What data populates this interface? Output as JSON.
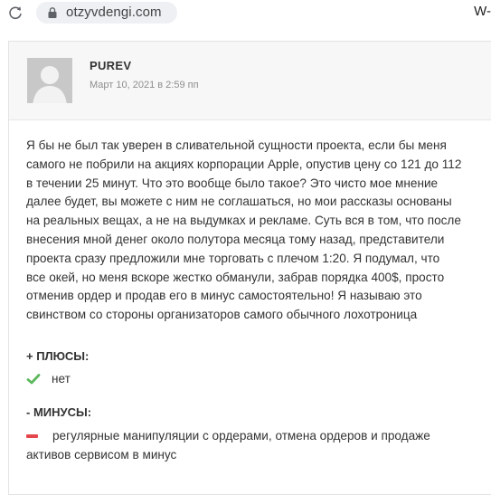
{
  "browser": {
    "url": "otzyvdengi.com",
    "tab_fragment": "W-"
  },
  "comment": {
    "author": "PUREV",
    "date": "Март 10, 2021 в 2:59 пп",
    "text": "Я бы не был так уверен в сливательной сущности проекта, если бы меня\nсамого не побрили на акциях корпорации Apple, опустив цену со 121 до 112\nв течении 25 минут. Что это вообще было такое? Это чисто мое мнение\nдалее будет, вы можете с ним не соглашаться, но мои рассказы основаны\nна реальных вещах, а не на выдумках и рекламе. Суть вся в том, что после\nвнесения мной денег около полутора месяца тому назад, представители\nпроекта сразу предложили мне торговать с плечом 1:20. Я подумал, что\nвсе окей, но меня вскоре жестко обманули, забрав порядка 400$, просто\nотменив ордер и продав его в минус самостоятельно! Я называю это\nсвинством со стороны организаторов самого обычного лохотроница",
    "pros_label": "+ ПЛЮСЫ:",
    "pros_text": "нет",
    "cons_label": "- МИНУСЫ:",
    "cons_text": "регулярные манипуляции с ордерами, отмена ордеров и продаже активов сервисом в минус"
  },
  "icons": {
    "reload": "reload-icon",
    "lock": "lock-icon",
    "check": "check-icon",
    "minus": "minus-icon"
  },
  "colors": {
    "check": "#5cb85c",
    "minus": "#e4464b",
    "header_bg": "#f7f7f7"
  }
}
